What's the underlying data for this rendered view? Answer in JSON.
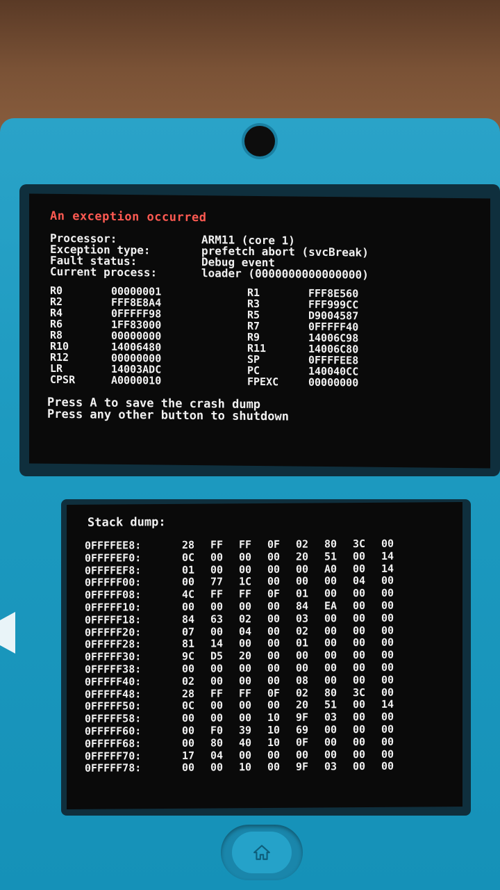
{
  "top_screen": {
    "title": "An exception occurred",
    "info": [
      {
        "label": "Processor:",
        "value": "ARM11 (core 1)"
      },
      {
        "label": "Exception type:",
        "value": "prefetch abort (svcBreak)"
      },
      {
        "label": "Fault status:",
        "value": "Debug event"
      },
      {
        "label": "Current process:",
        "value": "loader (0000000000000000)"
      }
    ],
    "registers_left": [
      {
        "name": "R0",
        "value": "00000001"
      },
      {
        "name": "R2",
        "value": "FFF8E8A4"
      },
      {
        "name": "R4",
        "value": "0FFFFF98"
      },
      {
        "name": "R6",
        "value": "1FF83000"
      },
      {
        "name": "R8",
        "value": "00000000"
      },
      {
        "name": "R10",
        "value": "14006480"
      },
      {
        "name": "R12",
        "value": "00000000"
      },
      {
        "name": "LR",
        "value": "14003ADC"
      },
      {
        "name": "CPSR",
        "value": "A0000010"
      }
    ],
    "registers_right": [
      {
        "name": "R1",
        "value": "FFF8E560"
      },
      {
        "name": "R3",
        "value": "FFF999CC"
      },
      {
        "name": "R5",
        "value": "D9004587"
      },
      {
        "name": "R7",
        "value": "0FFFFF40"
      },
      {
        "name": "R9",
        "value": "14006C98"
      },
      {
        "name": "R11",
        "value": "14006C80"
      },
      {
        "name": "SP",
        "value": "0FFFFEE8"
      },
      {
        "name": "PC",
        "value": "140040CC"
      },
      {
        "name": "FPEXC",
        "value": "00000000"
      }
    ],
    "prompt_save": "Press A to save the crash dump",
    "prompt_shutdown": "Press any other button to shutdown"
  },
  "bottom_screen": {
    "title": "Stack dump:",
    "rows": [
      {
        "addr": "0FFFFEE8:",
        "bytes": [
          "28",
          "FF",
          "FF",
          "0F",
          "02",
          "80",
          "3C",
          "00"
        ]
      },
      {
        "addr": "0FFFFEF0:",
        "bytes": [
          "0C",
          "00",
          "00",
          "00",
          "20",
          "51",
          "00",
          "14"
        ]
      },
      {
        "addr": "0FFFFEF8:",
        "bytes": [
          "01",
          "00",
          "00",
          "00",
          "00",
          "A0",
          "00",
          "14"
        ]
      },
      {
        "addr": "0FFFFF00:",
        "bytes": [
          "00",
          "77",
          "1C",
          "00",
          "00",
          "00",
          "04",
          "00"
        ]
      },
      {
        "addr": "0FFFFF08:",
        "bytes": [
          "4C",
          "FF",
          "FF",
          "0F",
          "01",
          "00",
          "00",
          "00"
        ]
      },
      {
        "addr": "0FFFFF10:",
        "bytes": [
          "00",
          "00",
          "00",
          "00",
          "84",
          "EA",
          "00",
          "00"
        ]
      },
      {
        "addr": "0FFFFF18:",
        "bytes": [
          "84",
          "63",
          "02",
          "00",
          "03",
          "00",
          "00",
          "00"
        ]
      },
      {
        "addr": "0FFFFF20:",
        "bytes": [
          "07",
          "00",
          "04",
          "00",
          "02",
          "00",
          "00",
          "00"
        ]
      },
      {
        "addr": "0FFFFF28:",
        "bytes": [
          "81",
          "14",
          "00",
          "00",
          "01",
          "00",
          "00",
          "00"
        ]
      },
      {
        "addr": "0FFFFF30:",
        "bytes": [
          "9C",
          "D5",
          "20",
          "00",
          "00",
          "00",
          "00",
          "00"
        ]
      },
      {
        "addr": "0FFFFF38:",
        "bytes": [
          "00",
          "00",
          "00",
          "00",
          "00",
          "00",
          "00",
          "00"
        ]
      },
      {
        "addr": "0FFFFF40:",
        "bytes": [
          "02",
          "00",
          "00",
          "00",
          "08",
          "00",
          "00",
          "00"
        ]
      },
      {
        "addr": "0FFFFF48:",
        "bytes": [
          "28",
          "FF",
          "FF",
          "0F",
          "02",
          "80",
          "3C",
          "00"
        ]
      },
      {
        "addr": "0FFFFF50:",
        "bytes": [
          "0C",
          "00",
          "00",
          "00",
          "20",
          "51",
          "00",
          "14"
        ]
      },
      {
        "addr": "0FFFFF58:",
        "bytes": [
          "00",
          "00",
          "00",
          "10",
          "9F",
          "03",
          "00",
          "00"
        ]
      },
      {
        "addr": "0FFFFF60:",
        "bytes": [
          "00",
          "F0",
          "39",
          "10",
          "69",
          "00",
          "00",
          "00"
        ]
      },
      {
        "addr": "0FFFFF68:",
        "bytes": [
          "00",
          "80",
          "40",
          "10",
          "0F",
          "00",
          "00",
          "00"
        ]
      },
      {
        "addr": "0FFFFF70:",
        "bytes": [
          "17",
          "04",
          "00",
          "00",
          "00",
          "00",
          "00",
          "00"
        ]
      },
      {
        "addr": "0FFFFF78:",
        "bytes": [
          "00",
          "00",
          "10",
          "00",
          "9F",
          "03",
          "00",
          "00"
        ]
      }
    ]
  },
  "colors": {
    "console_body": "#1d9ac0",
    "screen_bg": "#0a0a0a",
    "text": "#f1f1f1",
    "error_title": "#ff5a52"
  },
  "icons": {
    "home": "home-icon",
    "camera": "camera-icon"
  }
}
